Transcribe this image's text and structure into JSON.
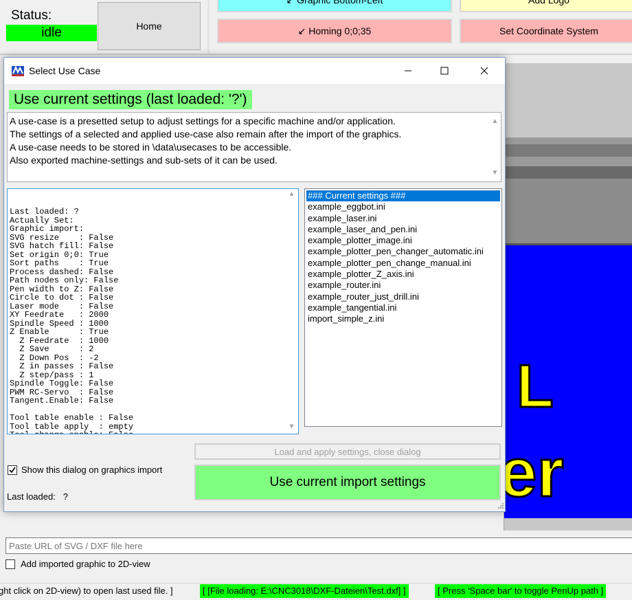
{
  "main": {
    "status_label": "Status:",
    "status_value": "idle",
    "home_label": "Home",
    "buttons": {
      "graphic_bottom_left": "↙ Graphic Bottom-Left",
      "add_logo": "Add Logo",
      "homing": "↙ Homing 0;0;35",
      "set_coordinate_system": "Set Coordinate System"
    },
    "url_placeholder": "Paste URL of SVG / DXF file here",
    "add_imported_label": "Add imported graphic to 2D-view",
    "statusbar": {
      "part1": "ght click on 2D-view) to open last used file. ]",
      "part2": "[ [File loading: E:\\CNC3018\\DXF-Dateien\\Test.dxf] ]",
      "part3": "[ Press 'Space bar' to toggle PenUp path ]"
    },
    "view2d_text": [
      "L",
      "er"
    ]
  },
  "dialog": {
    "title": "Select Use Case",
    "heading": "Use current settings (last loaded: '?')",
    "description": [
      "A use-case is a presetted setup to adjust settings for a specific machine and/or application.",
      "The settings of a selected and applied use-case also remain after the import of the graphics.",
      "A use-case needs to be stored in \\data\\usecases to be accessible.",
      "Also exported machine-settings and sub-sets of it can be used."
    ],
    "settings_text": "Last loaded: ?\nActually Set:\nGraphic import:\nSVG resize    : False\nSVG hatch fill: False\nSet origin 0;0: True\nSort paths    : True\nProcess dashed: False\nPath nodes only: False\nPen width to Z: False\nCircle to dot : False\nLaser mode    : False\nXY Feedrate   : 2000\nSpindle Speed : 1000\nZ Enable      : True\n  Z Feedrate  : 1000\n  Z Save      : 2\n  Z Down Pos  : -2\n  Z in passes : False\n  Z step/pass : 1\nSpindle Toggle: False\nPWM RC-Servo  : False\nTangent.Enable: False\n\nTool table enable : False\nTool table apply  : empty\nTool change enable: False",
    "use_cases": [
      "### Current settings ###",
      "example_eggbot.ini",
      "example_laser.ini",
      "example_laser_and_pen.ini",
      "example_plotter_image.ini",
      "example_plotter_pen_changer_automatic.ini",
      "example_plotter_pen_change_manual.ini",
      "example_plotter_Z_axis.ini",
      "example_router.ini",
      "example_router_just_drill.ini",
      "example_tangential.ini",
      "import_simple_z.ini"
    ],
    "selected_index": 0,
    "load_apply_label": "Load and apply settings, close dialog",
    "use_current_label": "Use current import settings",
    "show_dialog_label": "Show this dialog on graphics import",
    "show_dialog_checked": true,
    "last_loaded_label": "Last loaded:",
    "last_loaded_value": "?"
  },
  "colors": {
    "green": "#00ff00",
    "light_green": "#80ff80",
    "cyan": "#80ffff",
    "pink": "#ffb4b4",
    "light_yellow": "#ffffc0",
    "selection_blue": "#0078d7",
    "canvas_blue": "#0000ff",
    "text_yellow": "#ffff00"
  }
}
